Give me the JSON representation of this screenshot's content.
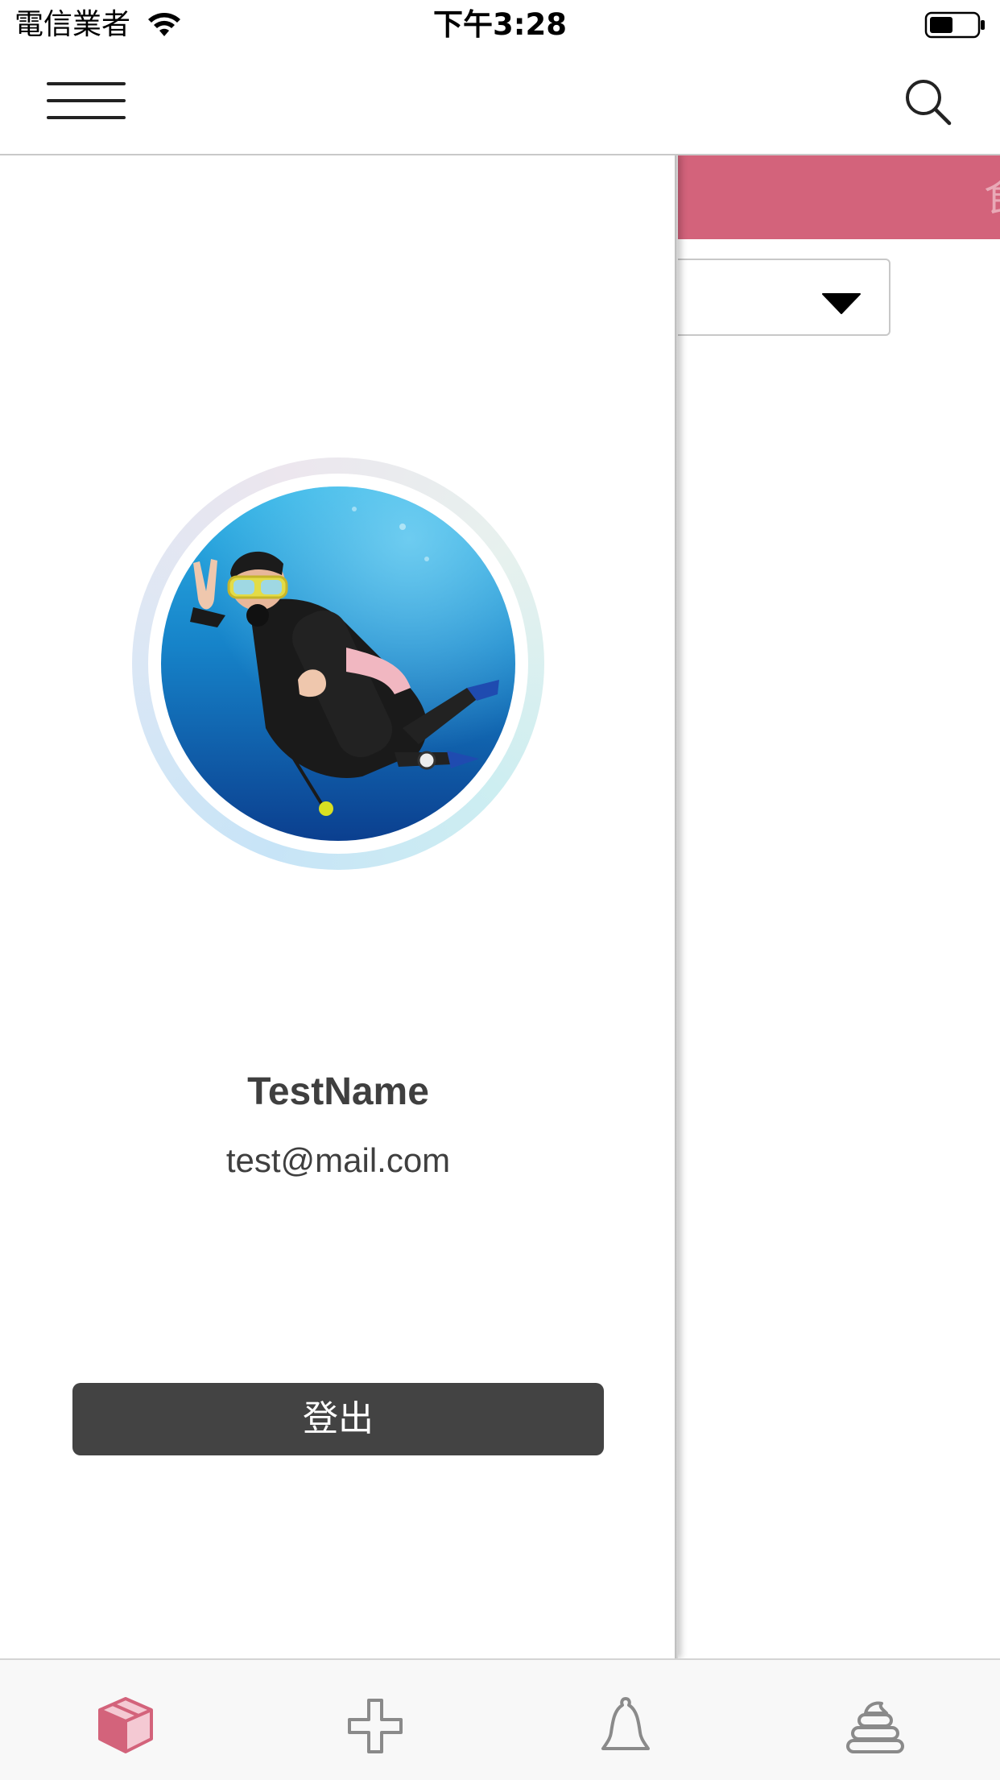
{
  "status_bar": {
    "carrier": "電信業者",
    "time": "下午3:28",
    "battery_level": 0.5,
    "icons": [
      "wifi-icon",
      "battery-icon"
    ]
  },
  "nav_bar": {
    "left_icon": "hamburger-menu-icon",
    "right_icon": "search-icon"
  },
  "main": {
    "banner_color": "#d3637b",
    "banner_text_partial": "食",
    "select_value": ""
  },
  "drawer": {
    "avatar_icon": "avatar",
    "user_name": "TestName",
    "user_email": "test@mail.com",
    "logout_label": "登出"
  },
  "tab_bar": {
    "tabs": [
      {
        "icon": "box-icon",
        "selected": true,
        "color": "#d3637b"
      },
      {
        "icon": "plus-icon",
        "selected": false,
        "color": "#8a8a8a"
      },
      {
        "icon": "bell-icon",
        "selected": false,
        "color": "#8a8a8a"
      },
      {
        "icon": "poop-icon",
        "selected": false,
        "color": "#8a8a8a"
      }
    ]
  },
  "colors": {
    "accent": "#d3637b",
    "dark_button": "#434343",
    "text": "#3f3f3f"
  }
}
